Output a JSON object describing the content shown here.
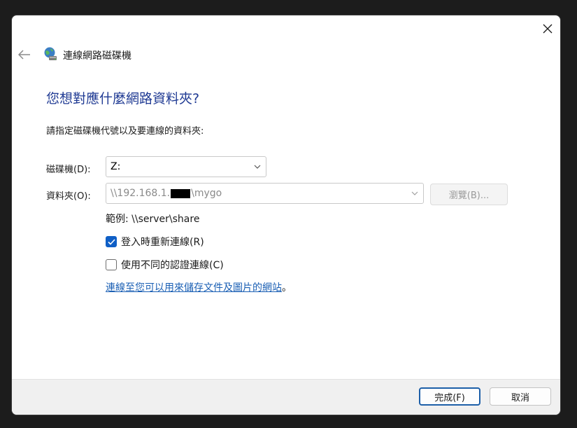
{
  "window": {
    "title": "連線網路磁碟機",
    "close_icon": "close-icon",
    "back_icon": "back-arrow-icon"
  },
  "content": {
    "heading": "您想對應什麼網路資料夾?",
    "instruction": "請指定磁碟機代號以及要連線的資料夾:",
    "drive": {
      "label": "磁碟機(D):",
      "value": "Z:"
    },
    "folder": {
      "label": "資料夾(O):",
      "value_prefix": "\\\\192.168.1.",
      "value_suffix": "\\mygo"
    },
    "browse_label": "瀏覽(B)...",
    "example": "範例: \\\\server\\share",
    "reconnect": {
      "label": "登入時重新連線(R)",
      "checked": true
    },
    "different_credentials": {
      "label": "使用不同的認證連線(C)",
      "checked": false
    },
    "link": {
      "text": "連線至您可以用來儲存文件及圖片的網站",
      "suffix": "。"
    }
  },
  "footer": {
    "finish_label": "完成(F)",
    "cancel_label": "取消"
  },
  "colors": {
    "heading": "#1f3a93",
    "accent": "#0f5fc6",
    "link": "#1a5fb4"
  }
}
